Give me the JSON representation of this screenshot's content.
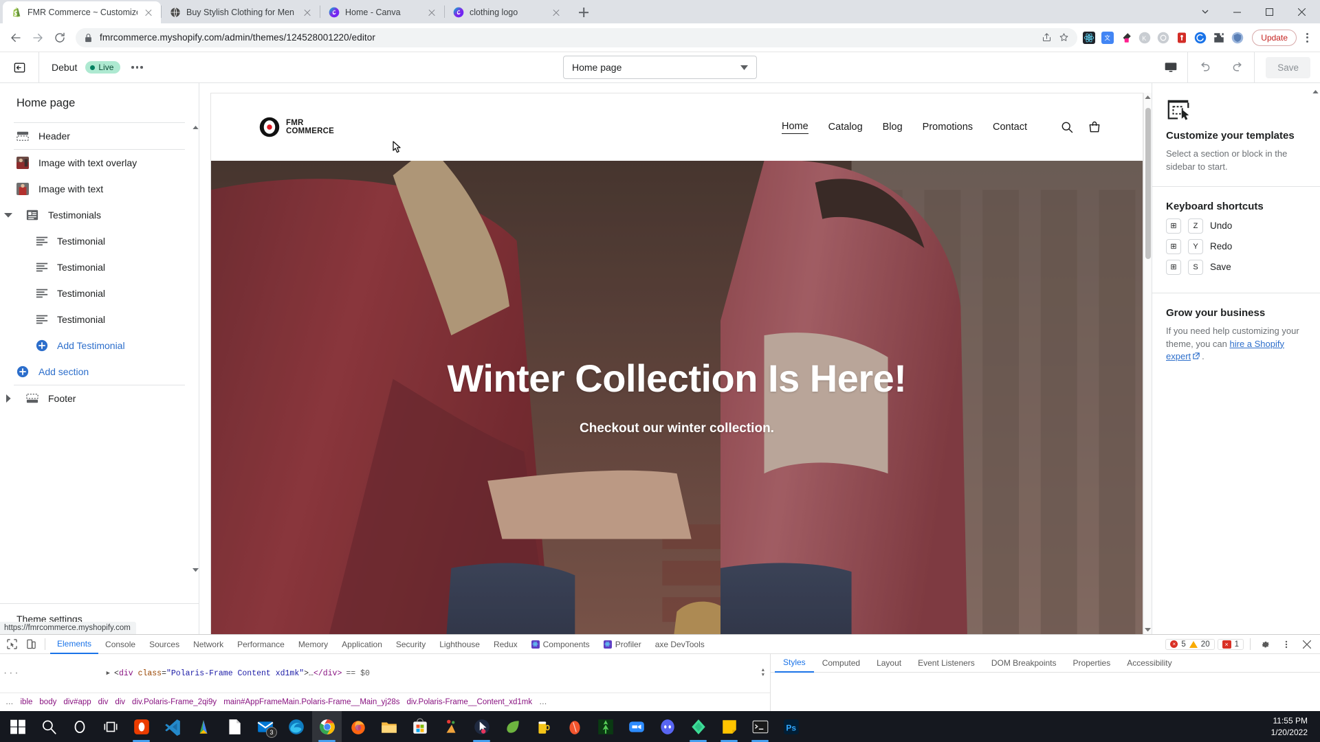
{
  "browser": {
    "tabs": [
      {
        "title": "FMR Commerce ~ Customize De",
        "favicon": "shopify-icon",
        "active": true
      },
      {
        "title": "Buy Stylish Clothing for Men | Fr",
        "favicon": "globe-icon",
        "active": false
      },
      {
        "title": "Home - Canva",
        "favicon": "canva-icon",
        "active": false
      },
      {
        "title": "clothing logo",
        "favicon": "canva-icon",
        "active": false
      }
    ],
    "new_tab_label": "+",
    "url": "fmrcommerce.myshopify.com/admin/themes/124528001220/editor",
    "update_label": "Update",
    "extensions": [
      "react-devtools-icon",
      "translate-icon",
      "colorpick-icon",
      "kameleoon-icon",
      "ghostery-icon",
      "lastpass-icon",
      "clarity-icon",
      "puzzle-icon",
      "privacy-icon"
    ],
    "status_url": "https://fmrcommerce.myshopify.com"
  },
  "editor": {
    "theme_name": "Debut",
    "live_label": "Live",
    "page_selector": "Home page",
    "save_label": "Save",
    "sidebar": {
      "title": "Home page",
      "items": [
        {
          "label": "Header",
          "icon": "header-icon",
          "type": "section"
        },
        {
          "label": "Image with text overlay",
          "icon": "image-thumb",
          "type": "section"
        },
        {
          "label": "Image with text",
          "icon": "image-thumb",
          "type": "section"
        },
        {
          "label": "Testimonials",
          "icon": "testimonials-icon",
          "type": "section",
          "expanded": true
        },
        {
          "label": "Testimonial",
          "icon": "block-icon",
          "type": "block"
        },
        {
          "label": "Testimonial",
          "icon": "block-icon",
          "type": "block"
        },
        {
          "label": "Testimonial",
          "icon": "block-icon",
          "type": "block"
        },
        {
          "label": "Testimonial",
          "icon": "block-icon",
          "type": "block"
        },
        {
          "label": "Add Testimonial",
          "icon": "plus-circle-icon",
          "type": "add-block"
        },
        {
          "label": "Add section",
          "icon": "plus-circle-icon",
          "type": "add-section"
        },
        {
          "label": "Footer",
          "icon": "footer-icon",
          "type": "section"
        }
      ],
      "footer_label": "Theme settings"
    },
    "right_panel": {
      "templates_heading": "Customize your templates",
      "templates_body": "Select a section or block in the sidebar to start.",
      "shortcuts_heading": "Keyboard shortcuts",
      "shortcuts": [
        {
          "mod": "⊞",
          "key": "Z",
          "label": "Undo"
        },
        {
          "mod": "⊞",
          "key": "Y",
          "label": "Redo"
        },
        {
          "mod": "⊞",
          "key": "S",
          "label": "Save"
        }
      ],
      "grow_heading": "Grow your business",
      "grow_body_before": "If you need help customizing your theme, you can ",
      "grow_link": "hire a Shopify expert",
      "grow_body_after": "."
    }
  },
  "store_preview": {
    "logo_line1": "FMR",
    "logo_line2": "COMMERCE",
    "nav": [
      {
        "label": "Home",
        "current": true
      },
      {
        "label": "Catalog",
        "current": false
      },
      {
        "label": "Blog",
        "current": false
      },
      {
        "label": "Promotions",
        "current": false
      },
      {
        "label": "Contact",
        "current": false
      }
    ],
    "hero_title": "Winter Collection Is Here!",
    "hero_subtitle": "Checkout our winter collection."
  },
  "devtools": {
    "tabs": [
      {
        "label": "Elements",
        "active": true
      },
      {
        "label": "Console",
        "active": false
      },
      {
        "label": "Sources",
        "active": false
      },
      {
        "label": "Network",
        "active": false
      },
      {
        "label": "Performance",
        "active": false
      },
      {
        "label": "Memory",
        "active": false
      },
      {
        "label": "Application",
        "active": false
      },
      {
        "label": "Security",
        "active": false
      },
      {
        "label": "Lighthouse",
        "active": false
      },
      {
        "label": "Redux",
        "active": false
      },
      {
        "label": "Components",
        "active": false,
        "icon": "react-icon"
      },
      {
        "label": "Profiler",
        "active": false,
        "icon": "react-icon"
      },
      {
        "label": "axe DevTools",
        "active": false
      }
    ],
    "errors": "5",
    "warnings": "20",
    "issues": "1",
    "dom_node": {
      "tag": "div",
      "attr_name": "class",
      "attr_value": "\"Polaris-Frame  Content xd1mk\"",
      "ellipsis": "…",
      "close": "</div>",
      "selected": "== $0"
    },
    "breadcrumbs": [
      "…",
      "ible",
      "body",
      "div#app",
      "div",
      "div",
      "div.Polaris-Frame_2qi9y",
      "main#AppFrameMain.Polaris-Frame__Main_yj28s",
      "div.Polaris-Frame__Content_xd1mk",
      "…"
    ],
    "styles_tabs": [
      {
        "label": "Styles",
        "active": true
      },
      {
        "label": "Computed",
        "active": false
      },
      {
        "label": "Layout",
        "active": false
      },
      {
        "label": "Event Listeners",
        "active": false
      },
      {
        "label": "DOM Breakpoints",
        "active": false
      },
      {
        "label": "Properties",
        "active": false
      },
      {
        "label": "Accessibility",
        "active": false
      }
    ]
  },
  "taskbar": {
    "items": [
      {
        "name": "start-button",
        "icon": "windows-icon"
      },
      {
        "name": "search-button",
        "icon": "search-icon"
      },
      {
        "name": "cortana-button",
        "icon": "cortana-icon"
      },
      {
        "name": "task-view-button",
        "icon": "taskview-icon"
      },
      {
        "name": "taskbar-app-office",
        "icon": "office-icon",
        "running": true
      },
      {
        "name": "taskbar-app-vscode",
        "icon": "vscode-icon"
      },
      {
        "name": "taskbar-app-adsense",
        "icon": "adsense-icon"
      },
      {
        "name": "taskbar-app-notepad",
        "icon": "notepad-icon"
      },
      {
        "name": "taskbar-app-mail",
        "icon": "mail-icon",
        "badge": "3"
      },
      {
        "name": "taskbar-app-edge",
        "icon": "edge-icon"
      },
      {
        "name": "taskbar-app-chrome",
        "icon": "chrome-icon",
        "running": true,
        "active": true
      },
      {
        "name": "taskbar-app-firefox",
        "icon": "firefox-icon"
      },
      {
        "name": "taskbar-app-explorer",
        "icon": "explorer-icon"
      },
      {
        "name": "taskbar-app-store",
        "icon": "store-icon"
      },
      {
        "name": "taskbar-app-party",
        "icon": "party-icon"
      },
      {
        "name": "taskbar-app-cursor",
        "icon": "cursor-app-icon",
        "running": true
      },
      {
        "name": "taskbar-app-mint",
        "icon": "leaf-icon"
      },
      {
        "name": "taskbar-app-beer",
        "icon": "beer-icon"
      },
      {
        "name": "taskbar-app-egg",
        "icon": "egg-icon"
      },
      {
        "name": "taskbar-app-tree",
        "icon": "tree-icon"
      },
      {
        "name": "taskbar-app-zoom",
        "icon": "zoom-icon"
      },
      {
        "name": "taskbar-app-discord",
        "icon": "discord-icon"
      },
      {
        "name": "taskbar-app-gem",
        "icon": "gem-icon",
        "running": true
      },
      {
        "name": "taskbar-app-notes",
        "icon": "notes-icon",
        "running": true
      },
      {
        "name": "taskbar-app-terminal",
        "icon": "terminal-icon",
        "running": true
      },
      {
        "name": "taskbar-app-photoshop",
        "icon": "photoshop-icon"
      }
    ],
    "time": "11:55 PM",
    "date": "1/20/2022"
  }
}
